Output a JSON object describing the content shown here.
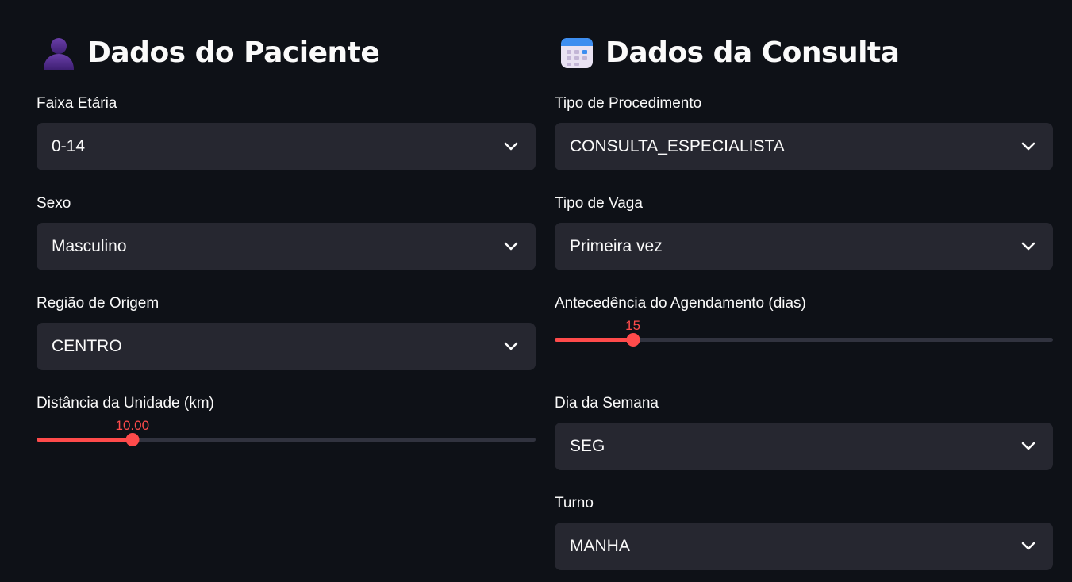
{
  "colors": {
    "background": "#0e1117",
    "input_background": "#262730",
    "accent": "#ff4b4b",
    "text": "#fafafa",
    "track": "#31333f"
  },
  "patient": {
    "title": "Dados do Paciente",
    "icon": "bust-in-silhouette-icon",
    "age_group": {
      "label": "Faixa Etária",
      "value": "0-14"
    },
    "sex": {
      "label": "Sexo",
      "value": "Masculino"
    },
    "region": {
      "label": "Região de Origem",
      "value": "CENTRO"
    },
    "distance": {
      "label": "Distância da Unidade (km)",
      "value": "10.00",
      "fraction": 0.192
    }
  },
  "consultation": {
    "title": "Dados da Consulta",
    "icon": "calendar-icon",
    "procedure_type": {
      "label": "Tipo de Procedimento",
      "value": "CONSULTA_ESPECIALISTA"
    },
    "slot_type": {
      "label": "Tipo de Vaga",
      "value": "Primeira vez"
    },
    "lead_time": {
      "label": "Antecedência do Agendamento (dias)",
      "value": "15",
      "fraction": 0.157
    },
    "weekday": {
      "label": "Dia da Semana",
      "value": "SEG"
    },
    "shift": {
      "label": "Turno",
      "value": "MANHA"
    }
  }
}
